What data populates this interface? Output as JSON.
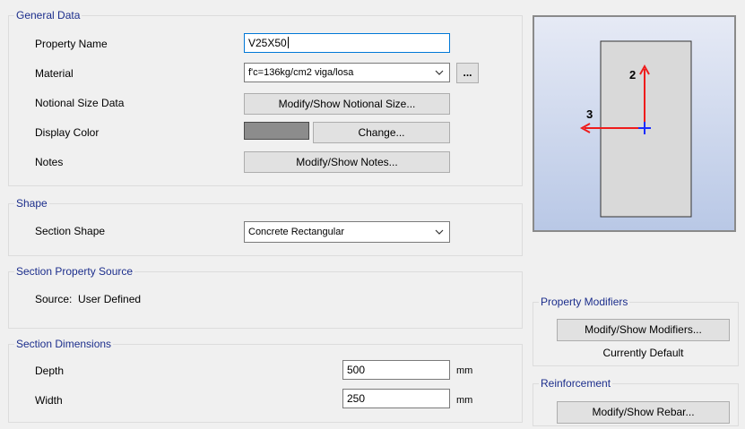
{
  "general": {
    "legend": "General Data",
    "property_name_label": "Property Name",
    "property_name_value": "V25X50",
    "material_label": "Material",
    "material_value": "f'c=136kg/cm2 viga/losa",
    "material_more": "...",
    "notional_label": "Notional Size Data",
    "notional_button": "Modify/Show Notional Size...",
    "color_label": "Display Color",
    "color_button": "Change...",
    "color_swatch": "#8c8c8c",
    "notes_label": "Notes",
    "notes_button": "Modify/Show Notes..."
  },
  "shape": {
    "legend": "Shape",
    "section_shape_label": "Section Shape",
    "section_shape_value": "Concrete Rectangular"
  },
  "source": {
    "legend": "Section Property Source",
    "text": "Source:  User Defined"
  },
  "dimensions": {
    "legend": "Section Dimensions",
    "depth_label": "Depth",
    "depth_value": "500",
    "depth_unit": "mm",
    "width_label": "Width",
    "width_value": "250",
    "width_unit": "mm"
  },
  "preview": {
    "axis2": "2",
    "axis3": "3",
    "bg_top": "#e6eaf5",
    "bg_bottom": "#b9c8e6",
    "section_fill": "#d9d9d9",
    "arrow_color": "#ee1c1c",
    "origin_color": "#1a2cff"
  },
  "modifiers": {
    "legend": "Property Modifiers",
    "button": "Modify/Show Modifiers...",
    "status": "Currently Default"
  },
  "reinforcement": {
    "legend": "Reinforcement",
    "button": "Modify/Show Rebar..."
  }
}
